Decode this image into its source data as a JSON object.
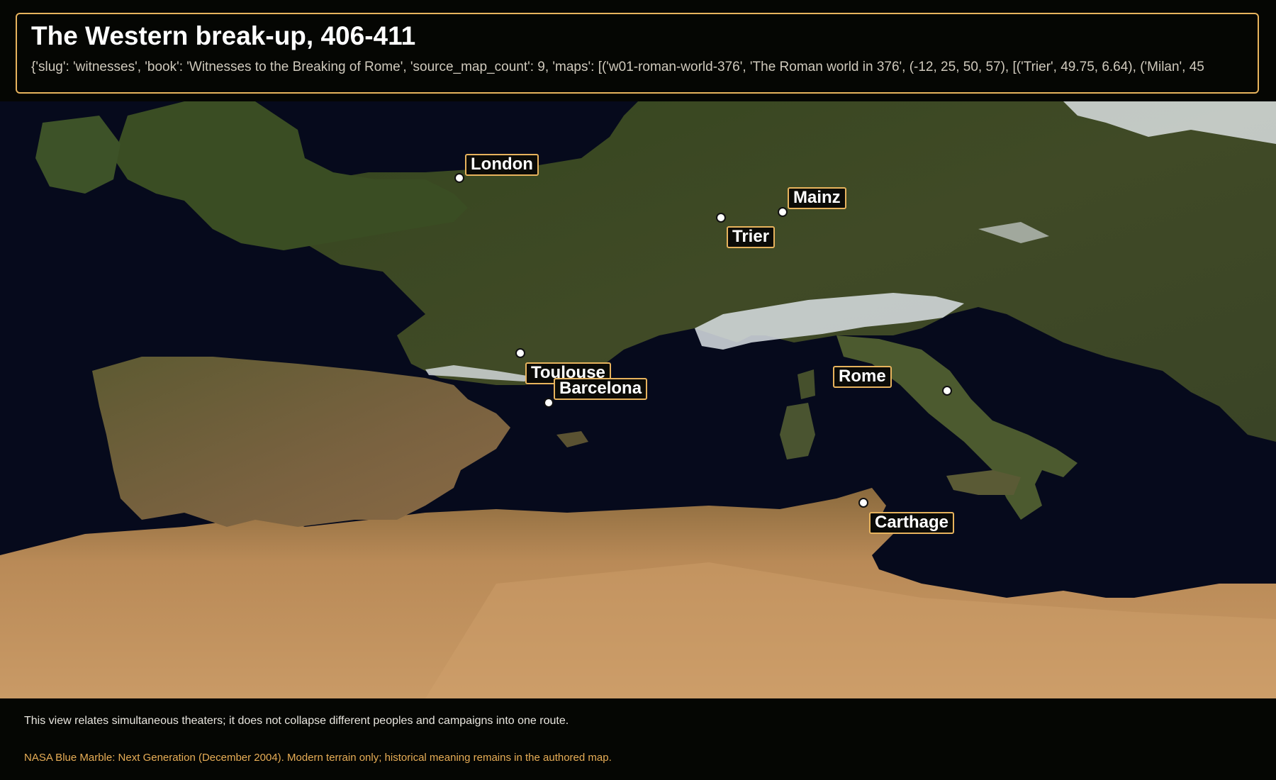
{
  "header": {
    "title": "The Western break-up, 406-411",
    "meta": "{'slug': 'witnesses', 'book': 'Witnesses to the Breaking of Rome', 'source_map_count': 9, 'maps': [('w01-roman-world-376', 'The Roman world in 376', (-12, 25, 50, 57), [('Trier', 49.75, 6.64), ('Milan', 45"
  },
  "map": {
    "cities": [
      {
        "name": "London"
      },
      {
        "name": "Mainz"
      },
      {
        "name": "Trier"
      },
      {
        "name": "Toulouse"
      },
      {
        "name": "Barcelona"
      },
      {
        "name": "Rome"
      },
      {
        "name": "Carthage"
      }
    ]
  },
  "footer": {
    "note": "This view relates simultaneous theaters; it does not collapse different peoples and campaigns into one route.",
    "credit": "NASA Blue Marble: Next Generation (December 2004). Modern terrain only; historical meaning remains in the authored map."
  },
  "colors": {
    "accent": "#e7b35d",
    "sea": "#070b1f",
    "land_north": "#3b4a25",
    "land_south": "#b98a57",
    "snow": "#e8eef2"
  }
}
